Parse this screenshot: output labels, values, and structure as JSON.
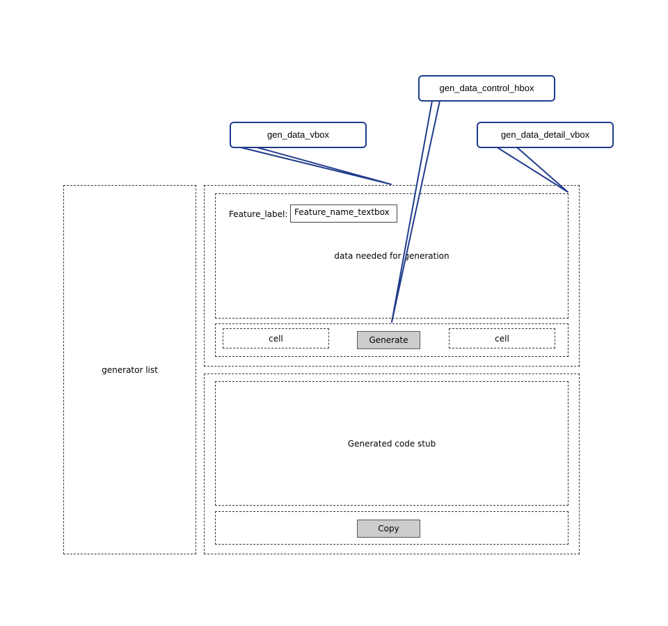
{
  "generator_list": {
    "label": "generator list"
  },
  "gen_data": {
    "feature_label": "Feature_label:",
    "feature_textbox_value": "Feature_name_textbox",
    "data_text": "data needed for generation",
    "controls": {
      "left_cell": "cell",
      "generate_label": "Generate",
      "right_cell": "cell"
    }
  },
  "output": {
    "code_text": "Generated code stub",
    "copy_label": "Copy"
  },
  "callouts": {
    "vbox": "gen_data_vbox",
    "control_hbox": "gen_data_control_hbox",
    "detail_vbox": "gen_data_detail_vbox"
  },
  "colors": {
    "callout_border": "#1f3a8a",
    "button_fill": "#cccccc"
  }
}
